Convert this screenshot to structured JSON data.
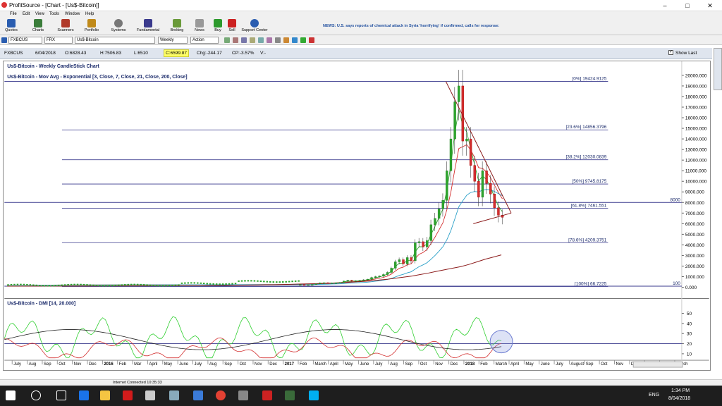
{
  "window": {
    "title": "ProfitSource - [Chart - [Us$-Bitcoin]]"
  },
  "menu": [
    "File",
    "Edit",
    "View",
    "Tools",
    "Window",
    "Help"
  ],
  "toolbar": {
    "buttons": [
      "Quotes",
      "Charts",
      "Scanners",
      "Portfolio",
      "Systems",
      "Fundamental",
      "Broking",
      "News",
      "Buy",
      "Sell",
      "Support Center"
    ],
    "news": "NEWS: U.S. says reports of chemical attack in Syria 'horrifying' if confirmed, calls for response:"
  },
  "symbol_bar": {
    "code": "FXBCUS",
    "exchange": "FRX",
    "name": "Us$-Bitcoin",
    "period": "Weekly",
    "action": "Action"
  },
  "info_bar": {
    "code": "FXBCUS",
    "date": "6/04/2018",
    "open": "O:6828.43",
    "high": "H:7506.83",
    "low": "L:6510",
    "close": "C:6599.87",
    "change": "Chg:-244.17",
    "change_pct": "CP:-3.57%",
    "volume": "V:-",
    "show_last": "Show Last"
  },
  "chart_data": {
    "type": "candlestick",
    "title": "Us$-Bitcoin - Weekly CandleStick Chart",
    "indicator_title": "Us$-Bitcoin - Mov Avg - Exponential [3, Close, 7, Close, 21, Close, 200, Close]",
    "ylim": [
      0,
      20000
    ],
    "y_ticks": [
      "20000.000",
      "19000.000",
      "18000.000",
      "17000.000",
      "16000.000",
      "15000.000",
      "14000.000",
      "13000.000",
      "12000.000",
      "11000.000",
      "10000.000",
      "9000.000",
      "8000.000",
      "7000.000",
      "6000.000",
      "5000.000",
      "4000.000",
      "3000.000",
      "2000.000",
      "1000.000",
      "0.000"
    ],
    "fib_levels": [
      {
        "label": "[0%] 19424.9125",
        "value": 19424.9125
      },
      {
        "label": "[23.6%] 14856.3796",
        "value": 14856.3796
      },
      {
        "label": "[38.2%] 12030.0839",
        "value": 12030.0839
      },
      {
        "label": "[50%] 9745.8175",
        "value": 9745.8175
      },
      {
        "label": "[61.8%] 7461.551",
        "value": 7461.551
      },
      {
        "label": "[78.6%] 4209.3751",
        "value": 4209.3751
      },
      {
        "label": "[100%] 66.7225",
        "value": 66.7225
      }
    ],
    "horizontal_lines": [
      {
        "label": "8000",
        "value": 8000
      },
      {
        "label": "100",
        "value": 100
      }
    ],
    "dmi": {
      "title": "Us$-Bitcoin - DMI [14, 20.000]",
      "ylim": [
        5,
        55
      ],
      "ticks": [
        "50",
        "40",
        "30",
        "20",
        "10"
      ],
      "threshold": 20
    },
    "x_labels": [
      "July",
      "Aug",
      "Sep",
      "Oct",
      "Nov",
      "Dec",
      "2016",
      "Feb",
      "Mar",
      "April",
      "May",
      "June",
      "July",
      "Aug",
      "Sep",
      "Oct",
      "Nov",
      "Dec",
      "2017",
      "Feb",
      "March",
      "April",
      "May",
      "June",
      "July",
      "Aug",
      "Sep",
      "Oct",
      "Nov",
      "Dec",
      "2018",
      "Feb",
      "March",
      "April",
      "May",
      "June",
      "July",
      "August",
      "Sep",
      "Oct",
      "Nov",
      "Dec",
      "2019",
      "Feb",
      "March"
    ],
    "closes": [
      250,
      230,
      240,
      260,
      330,
      420,
      430,
      380,
      410,
      420,
      450,
      580,
      650,
      580,
      610,
      640,
      700,
      750,
      920,
      1000,
      1050,
      1200,
      1400,
      1800,
      2400,
      2600,
      2200,
      2800,
      2500,
      4200,
      4300,
      3800,
      4400,
      5900,
      6500,
      7400,
      8200,
      11000,
      14000,
      17500,
      19000,
      13800,
      14000,
      11500,
      10000,
      8500,
      11000,
      9800,
      8800,
      7500,
      6800,
      6600
    ],
    "ema_long": [
      140,
      150,
      160,
      170,
      190,
      200,
      210,
      220,
      230,
      240,
      260,
      280,
      300,
      320,
      340,
      360,
      390,
      420,
      460,
      500,
      550,
      600,
      680,
      760,
      860,
      960,
      1060,
      1200,
      1340,
      1500,
      1650,
      1800,
      1950,
      2150,
      2400,
      2650,
      2850,
      3050
    ]
  },
  "status": {
    "text": "Internet Connected 10:35:33"
  },
  "taskbar": {
    "lang": "ENG",
    "time": "1:34 PM",
    "date": "8/04/2018"
  }
}
